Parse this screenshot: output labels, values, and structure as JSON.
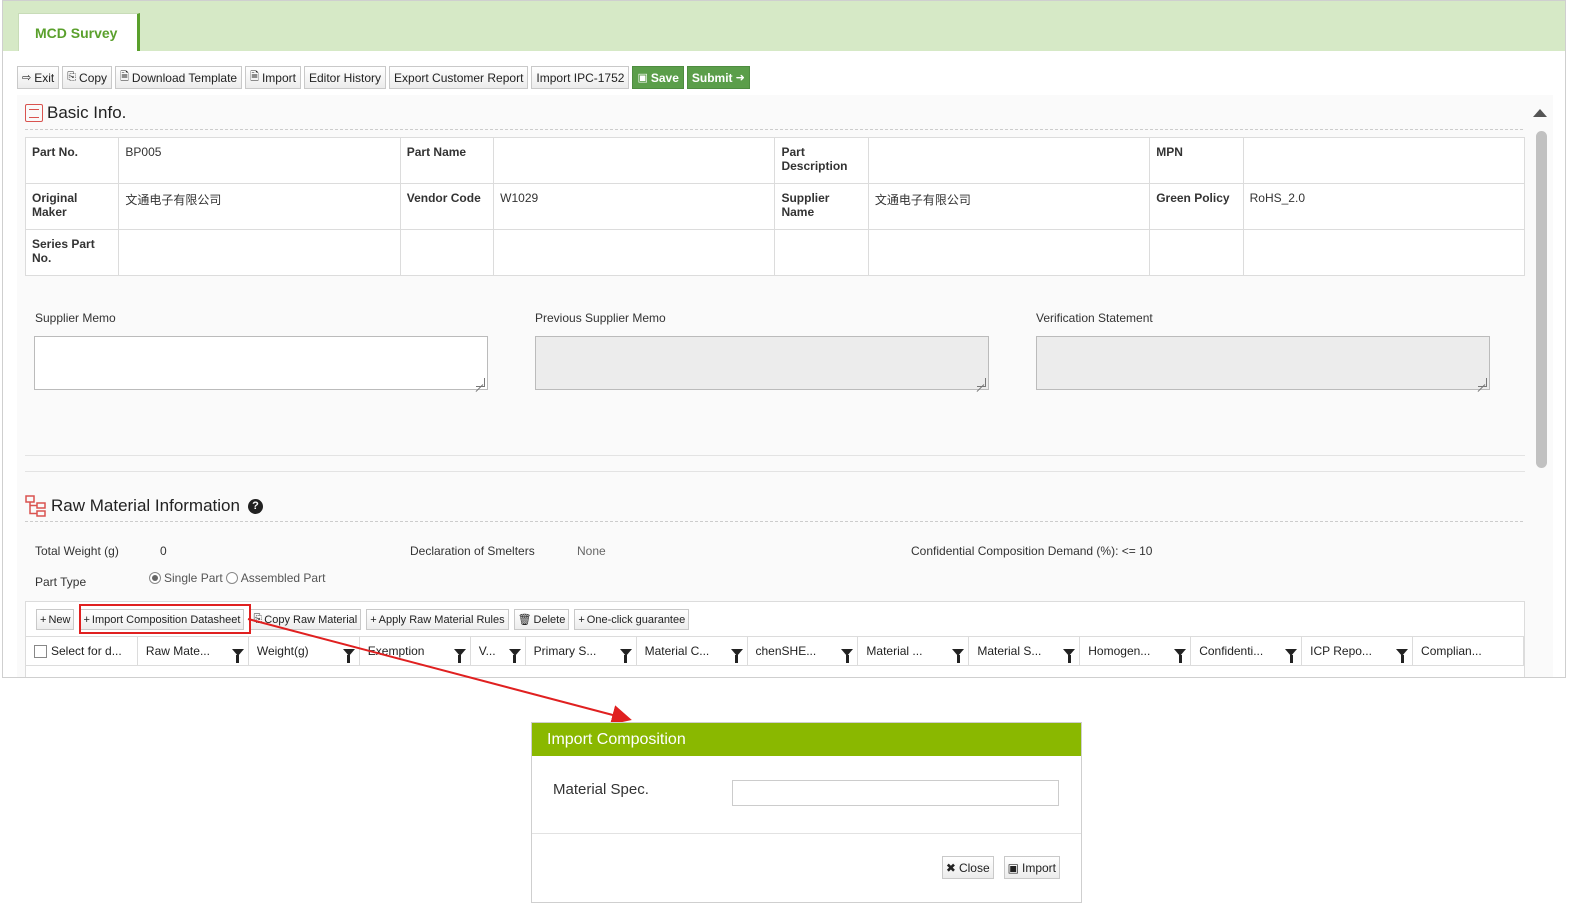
{
  "tab": {
    "label": "MCD Survey"
  },
  "toolbar": {
    "exit": "Exit",
    "copy": "Copy",
    "download_template": "Download Template",
    "import": "Import",
    "editor_history": "Editor History",
    "export_customer_report": "Export Customer Report",
    "import_ipc": "Import IPC-1752",
    "save": "Save",
    "submit": "Submit"
  },
  "basic_info": {
    "title": "Basic Info.",
    "part_no_label": "Part No.",
    "part_no": "BP005",
    "part_name_label": "Part Name",
    "part_name": "",
    "part_desc_label": "Part Description",
    "part_desc": "",
    "mpn_label": "MPN",
    "mpn": "",
    "original_maker_label": "Original Maker",
    "original_maker": "文通电子有限公司",
    "vendor_code_label": "Vendor Code",
    "vendor_code": "W1029",
    "supplier_name_label": "Supplier Name",
    "supplier_name": "文通电子有限公司",
    "green_policy_label": "Green Policy",
    "green_policy": "RoHS_2.0",
    "series_part_no_label": "Series Part No."
  },
  "memos": {
    "supplier_memo": "Supplier Memo",
    "previous_supplier_memo": "Previous Supplier Memo",
    "verification_statement": "Verification Statement"
  },
  "raw_material": {
    "title": "Raw Material Information",
    "total_weight_label": "Total Weight (g)",
    "total_weight": "0",
    "smelters_label": "Declaration of Smelters",
    "smelters": "None",
    "confidential_label": "Confidential Composition Demand (%): <= 10",
    "part_type_label": "Part Type",
    "single_part": "Single Part",
    "assembled_part": "Assembled Part"
  },
  "grid_toolbar": {
    "new": "New",
    "import_composition": "Import Composition Datasheet",
    "copy_raw": "Copy Raw Material",
    "apply_rules": "Apply Raw Material Rules",
    "delete": "Delete",
    "one_click": "One-click guarantee"
  },
  "grid_columns": [
    "Select for d...",
    "Raw Mate...",
    "Weight(g)",
    "Exemption",
    "V...",
    "Primary S...",
    "Material C...",
    "chenSHE...",
    "Material ...",
    "Material S...",
    "Homogen...",
    "Confidenti...",
    "ICP Repo...",
    "Complian..."
  ],
  "dialog": {
    "title": "Import Composition",
    "material_spec_label": "Material Spec.",
    "material_spec_value": "",
    "close": "Close",
    "import": "Import"
  },
  "colors": {
    "tab_bar": "#d6e9c6",
    "accent_green": "#5b9e4a",
    "dialog_header": "#8ab800",
    "highlight": "#e02020"
  }
}
